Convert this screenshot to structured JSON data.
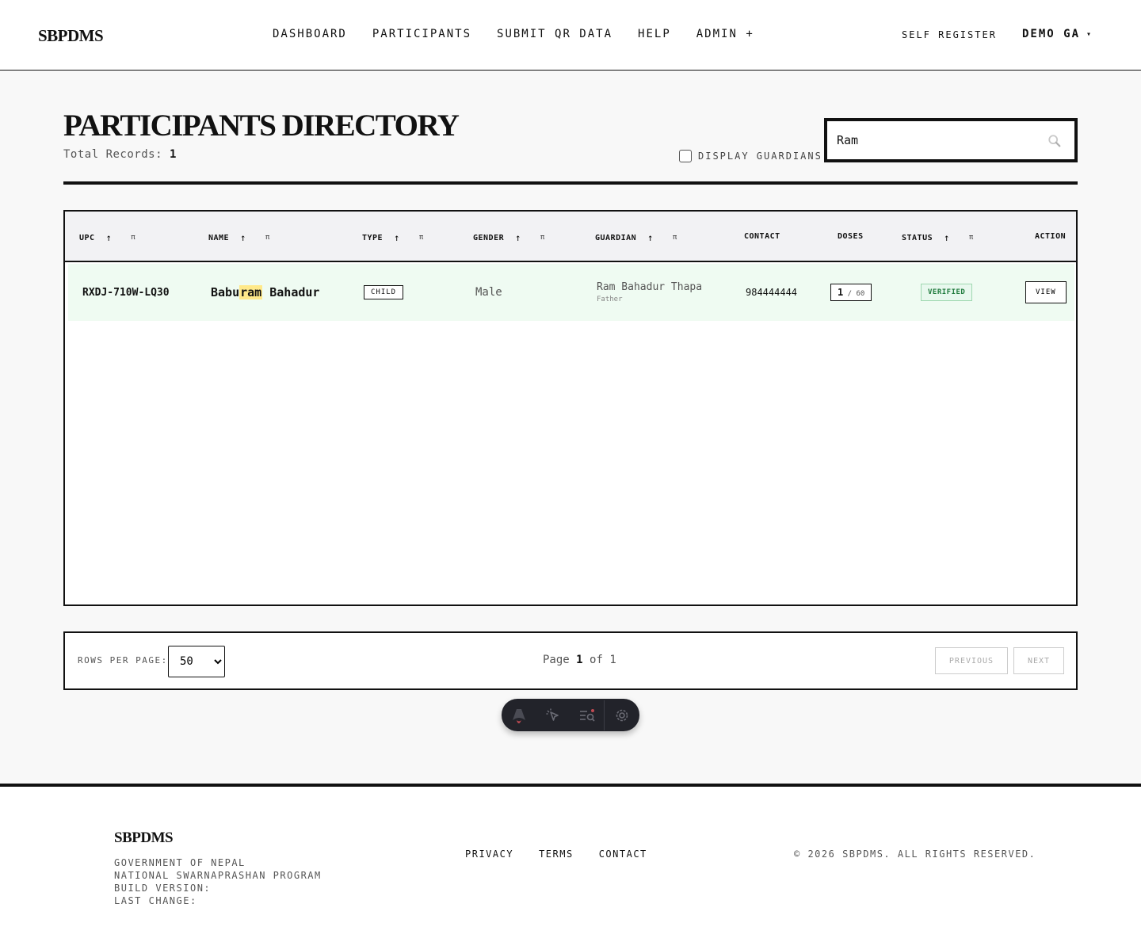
{
  "header": {
    "logo": "SBPDMS",
    "nav": [
      "DASHBOARD",
      "PARTICIPANTS",
      "SUBMIT QR DATA",
      "HELP",
      "ADMIN +"
    ],
    "self_register": "SELF REGISTER",
    "user": "DEMO GA",
    "user_caret": "▾"
  },
  "page": {
    "title": "PARTICIPANTS DIRECTORY",
    "total_label": "Total Records:",
    "total_value": "1",
    "display_guardians_label": "DISPLAY GUARDIANS",
    "display_guardians_checked": false,
    "search_value": "Ram",
    "search_icon": "search-icon"
  },
  "table": {
    "columns": [
      {
        "label": "UPC",
        "sortable": true
      },
      {
        "label": "NAME",
        "sortable": true
      },
      {
        "label": "TYPE",
        "sortable": true
      },
      {
        "label": "GENDER",
        "sortable": true
      },
      {
        "label": "GUARDIAN",
        "sortable": true
      },
      {
        "label": "CONTACT",
        "sortable": false
      },
      {
        "label": "DOSES",
        "sortable": false
      },
      {
        "label": "STATUS",
        "sortable": true
      },
      {
        "label": "ACTION",
        "sortable": false
      }
    ],
    "sort_icon": "↑",
    "pin_icon": "π",
    "rows": [
      {
        "upc": "RXDJ-710W-LQ30",
        "name_before": "Babu",
        "name_match": "ram",
        "name_after": " Bahadur",
        "type": "CHILD",
        "gender": "Male",
        "guardian_name": "Ram Bahadur Thapa",
        "guardian_relation": "Father",
        "contact": "984444444",
        "doses_taken": "1",
        "doses_sep": " / ",
        "doses_total": "60",
        "status": "VERIFIED",
        "action": "VIEW"
      }
    ]
  },
  "pagination": {
    "rows_per_page_label": "ROWS PER PAGE:",
    "rows_per_page": "50",
    "page_word": "Page",
    "current_page": "1",
    "of_word": "of",
    "total_pages": "1",
    "previous": "PREVIOUS",
    "next": "NEXT"
  },
  "devbar": {
    "icons": [
      "astro-logo-icon",
      "cursor-select-icon",
      "audit-list-icon",
      "settings-gear-icon"
    ]
  },
  "footer": {
    "logo": "SBPDMS",
    "lines": [
      "GOVERNMENT OF NEPAL",
      "NATIONAL SWARNAPRASHAN PROGRAM",
      "BUILD VERSION:",
      "LAST CHANGE:"
    ],
    "links": [
      "PRIVACY",
      "TERMS",
      "CONTACT"
    ],
    "copyright": "© 2026 SBPDMS. ALL RIGHTS RESERVED."
  },
  "colors": {
    "row_highlight": "#effbf2",
    "match_highlight": "#ffe98a",
    "verified_text": "#1e7a3c",
    "verified_bg": "#e8f8ee",
    "devbar_bg": "#22232a"
  }
}
